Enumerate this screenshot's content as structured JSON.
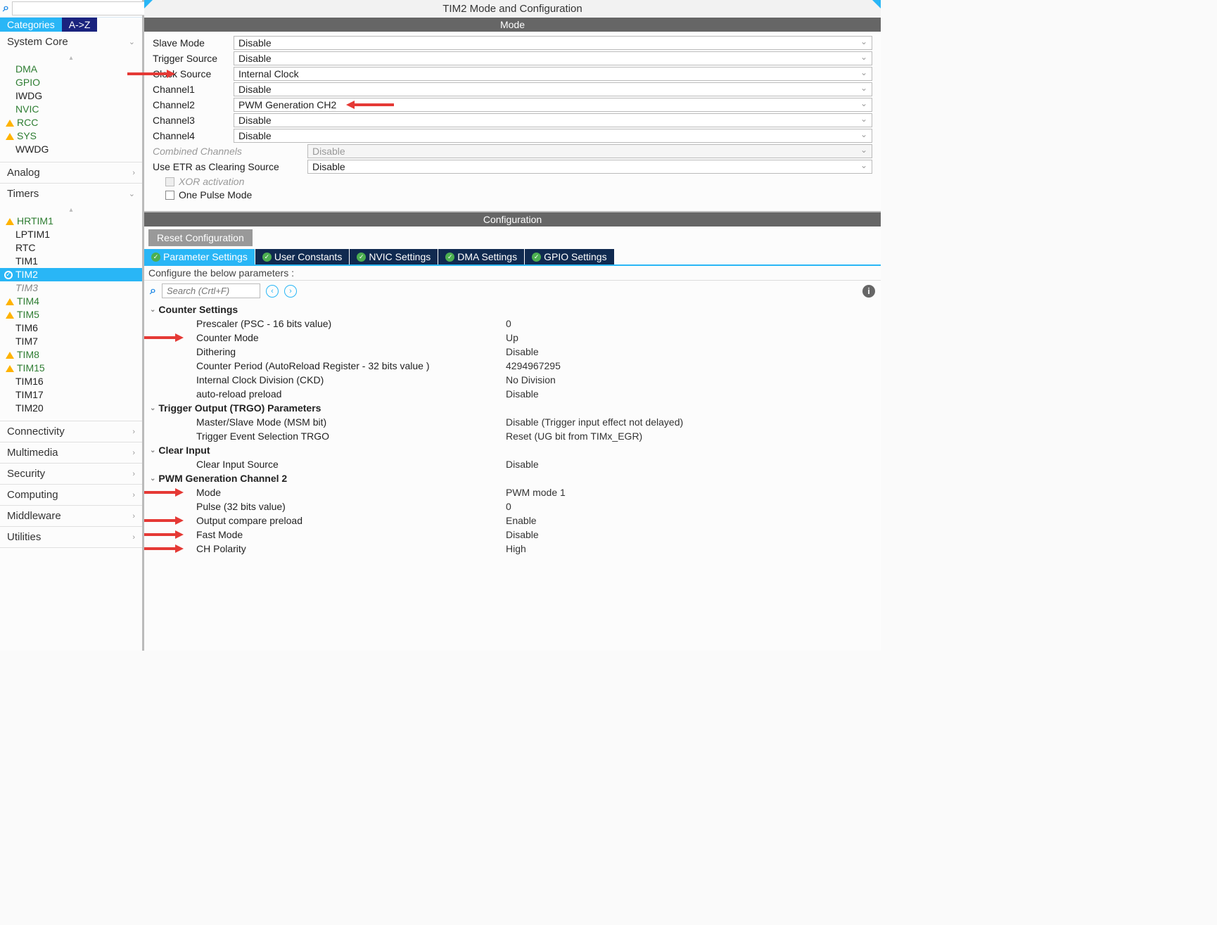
{
  "title": "TIM2 Mode and Configuration",
  "viewTabs": {
    "categories": "Categories",
    "az": "A->Z"
  },
  "sidebar": {
    "sections": [
      {
        "name": "System Core",
        "expanded": true,
        "showSortHint": true,
        "items": [
          {
            "label": "DMA",
            "style": "green"
          },
          {
            "label": "GPIO",
            "style": "green"
          },
          {
            "label": "IWDG",
            "style": "plain"
          },
          {
            "label": "NVIC",
            "style": "green"
          },
          {
            "label": "RCC",
            "style": "green",
            "warn": true
          },
          {
            "label": "SYS",
            "style": "green",
            "warn": true
          },
          {
            "label": "WWDG",
            "style": "plain"
          }
        ]
      },
      {
        "name": "Analog",
        "expanded": false
      },
      {
        "name": "Timers",
        "expanded": true,
        "showSortHint": true,
        "items": [
          {
            "label": "HRTIM1",
            "style": "green",
            "warn": true
          },
          {
            "label": "LPTIM1",
            "style": "plain"
          },
          {
            "label": "RTC",
            "style": "plain"
          },
          {
            "label": "TIM1",
            "style": "plain"
          },
          {
            "label": "TIM2",
            "style": "selected",
            "check": true
          },
          {
            "label": "TIM3",
            "style": "dim"
          },
          {
            "label": "TIM4",
            "style": "green",
            "warn": true
          },
          {
            "label": "TIM5",
            "style": "green",
            "warn": true
          },
          {
            "label": "TIM6",
            "style": "plain"
          },
          {
            "label": "TIM7",
            "style": "plain"
          },
          {
            "label": "TIM8",
            "style": "green",
            "warn": true
          },
          {
            "label": "TIM15",
            "style": "green",
            "warn": true
          },
          {
            "label": "TIM16",
            "style": "plain"
          },
          {
            "label": "TIM17",
            "style": "plain"
          },
          {
            "label": "TIM20",
            "style": "plain"
          }
        ]
      },
      {
        "name": "Connectivity",
        "expanded": false
      },
      {
        "name": "Multimedia",
        "expanded": false
      },
      {
        "name": "Security",
        "expanded": false
      },
      {
        "name": "Computing",
        "expanded": false
      },
      {
        "name": "Middleware",
        "expanded": false
      },
      {
        "name": "Utilities",
        "expanded": false
      }
    ]
  },
  "mode": {
    "header": "Mode",
    "rows": [
      {
        "label": "Slave Mode",
        "value": "Disable"
      },
      {
        "label": "Trigger Source",
        "value": "Disable"
      },
      {
        "label": "Clock Source",
        "value": "Internal Clock",
        "arrow": "left"
      },
      {
        "label": "Channel1",
        "value": "Disable"
      },
      {
        "label": "Channel2",
        "value": "PWM Generation CH2",
        "arrow": "right"
      },
      {
        "label": "Channel3",
        "value": "Disable"
      },
      {
        "label": "Channel4",
        "value": "Disable"
      },
      {
        "label": "Combined Channels",
        "value": "Disable",
        "disabled": true,
        "wide": true
      },
      {
        "label": "Use ETR as Clearing Source",
        "value": "Disable",
        "wide": true
      }
    ],
    "checks": [
      {
        "label": "XOR activation",
        "disabled": true
      },
      {
        "label": "One Pulse Mode",
        "disabled": false
      }
    ]
  },
  "config": {
    "header": "Configuration",
    "reset": "Reset Configuration",
    "tabs": [
      {
        "label": "Parameter Settings",
        "active": true
      },
      {
        "label": "User Constants"
      },
      {
        "label": "NVIC Settings"
      },
      {
        "label": "DMA Settings"
      },
      {
        "label": "GPIO Settings"
      }
    ],
    "hint": "Configure the below parameters :",
    "searchPlaceholder": "Search (Crtl+F)",
    "groups": [
      {
        "name": "Counter Settings",
        "rows": [
          {
            "key": "Prescaler (PSC - 16 bits value)",
            "val": "0"
          },
          {
            "key": "Counter Mode",
            "val": "Up",
            "arrow": true
          },
          {
            "key": "Dithering",
            "val": "Disable"
          },
          {
            "key": "Counter Period (AutoReload Register - 32 bits value )",
            "val": "4294967295"
          },
          {
            "key": "Internal Clock Division (CKD)",
            "val": "No Division"
          },
          {
            "key": "auto-reload preload",
            "val": "Disable"
          }
        ]
      },
      {
        "name": "Trigger Output (TRGO) Parameters",
        "rows": [
          {
            "key": "Master/Slave Mode (MSM bit)",
            "val": "Disable (Trigger input effect not delayed)"
          },
          {
            "key": "Trigger Event Selection TRGO",
            "val": "Reset (UG bit from TIMx_EGR)"
          }
        ]
      },
      {
        "name": "Clear Input",
        "rows": [
          {
            "key": "Clear Input Source",
            "val": "Disable"
          }
        ]
      },
      {
        "name": "PWM Generation Channel 2",
        "rows": [
          {
            "key": "Mode",
            "val": "PWM mode 1",
            "arrow": true
          },
          {
            "key": "Pulse (32 bits value)",
            "val": "0"
          },
          {
            "key": "Output compare preload",
            "val": "Enable",
            "arrow": true
          },
          {
            "key": "Fast Mode",
            "val": "Disable",
            "arrow": true
          },
          {
            "key": "CH Polarity",
            "val": "High",
            "arrow": true
          }
        ]
      }
    ]
  }
}
